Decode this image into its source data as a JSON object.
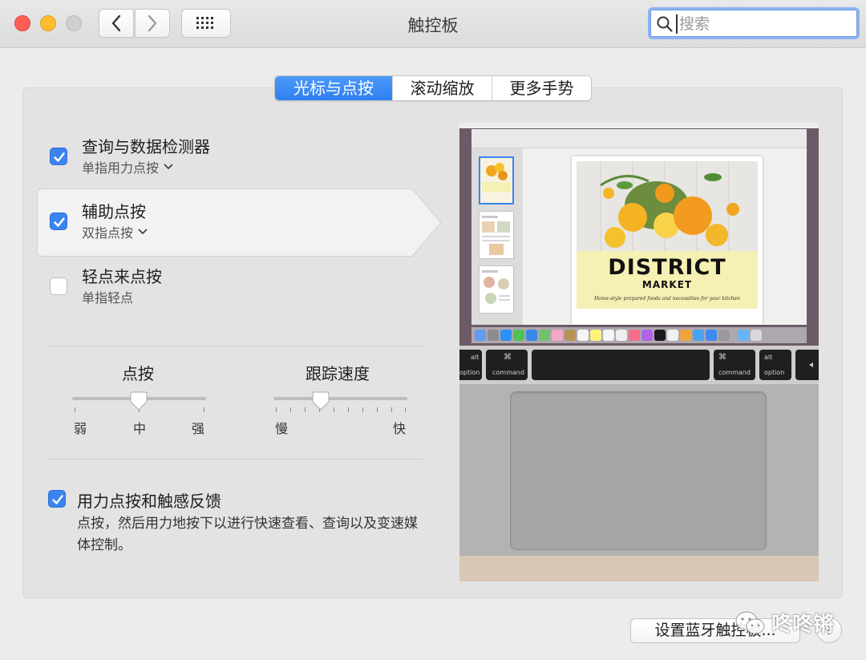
{
  "window": {
    "title": "触控板"
  },
  "search": {
    "placeholder": "搜索"
  },
  "tabs": [
    {
      "label": "光标与点按",
      "active": true
    },
    {
      "label": "滚动缩放",
      "active": false
    },
    {
      "label": "更多手势",
      "active": false
    }
  ],
  "options": [
    {
      "label": "查询与数据检测器",
      "sub": "单指用力点按",
      "checked": true,
      "has_menu": true
    },
    {
      "label": "辅助点按",
      "sub": "双指点按",
      "checked": true,
      "has_menu": true,
      "selected": true
    },
    {
      "label": "轻点来点按",
      "sub": "单指轻点",
      "checked": false,
      "has_menu": false
    }
  ],
  "click_slider": {
    "title": "点按",
    "labels": [
      "弱",
      "中",
      "强"
    ],
    "value_index": 1,
    "value_fraction": 0.5
  },
  "tracking_slider": {
    "title": "跟踪速度",
    "labels": [
      "慢",
      "快"
    ],
    "value_fraction": 0.35
  },
  "force_click": {
    "label": "用力点按和触感反馈",
    "checked": true,
    "description": "点按，然后用力地按下以进行快速查看、查询以及变速媒体控制。"
  },
  "preview": {
    "doc_title": "DISTRICT",
    "doc_subtitle": "MARKET",
    "doc_tagline": "Home-style prepared foods and necessities for your kitchen",
    "keys": [
      "alt",
      "option",
      "⌘",
      "command",
      "⌘",
      "command",
      "alt",
      "option"
    ]
  },
  "footer": {
    "bluetooth_button": "设置蓝牙触控板...",
    "help": "?"
  },
  "watermark": {
    "text": "咚咚锵"
  },
  "colors": {
    "accent": "#3b84f0",
    "close": "#fe5f57",
    "minimize": "#febc2e"
  }
}
